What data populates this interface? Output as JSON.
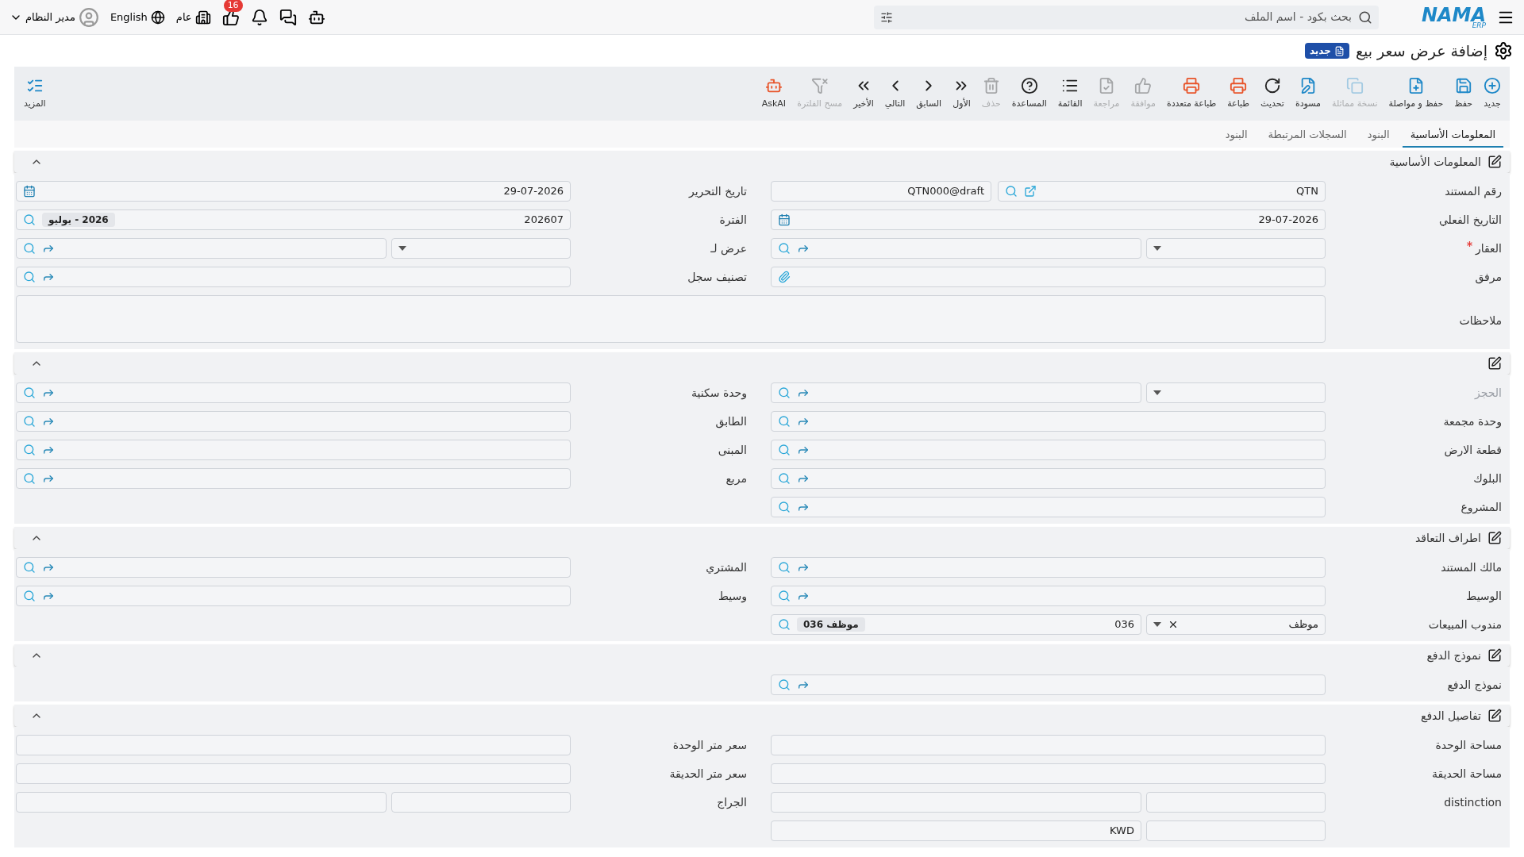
{
  "topbar": {
    "logo": "NAMA",
    "logo_sub": "ERP",
    "search": {
      "placeholder": "بحث بكود - اسم الملف"
    },
    "user": "مدير النظام",
    "language": "English",
    "scope": "عام",
    "notifications": "16"
  },
  "page": {
    "title": "إضافة عرض سعر بيع",
    "badge": "جديد"
  },
  "toolbar": [
    {
      "label": "جديد",
      "kind": "primary",
      "disabled": false
    },
    {
      "label": "حفظ",
      "kind": "primary",
      "disabled": false
    },
    {
      "label": "حفظ و مواصلة",
      "kind": "primary",
      "disabled": false
    },
    {
      "label": "نسخة مماثلة",
      "kind": "primary",
      "disabled": true
    },
    {
      "label": "مسودة",
      "kind": "primary",
      "disabled": false
    },
    {
      "label": "تحديث",
      "kind": "plain",
      "disabled": false
    },
    {
      "label": "طباعة",
      "kind": "print",
      "disabled": false
    },
    {
      "label": "طباعة متعددة",
      "kind": "print",
      "disabled": false
    },
    {
      "label": "موافقة",
      "kind": "plain",
      "disabled": true
    },
    {
      "label": "مراجعة",
      "kind": "plain",
      "disabled": true
    },
    {
      "label": "القائمة",
      "kind": "plain",
      "disabled": false
    },
    {
      "label": "المساعدة",
      "kind": "plain",
      "disabled": false
    },
    {
      "label": "حذف",
      "kind": "plain",
      "disabled": true
    },
    {
      "label": "الأول",
      "kind": "plain",
      "disabled": false
    },
    {
      "label": "السابق",
      "kind": "plain",
      "disabled": false
    },
    {
      "label": "التالي",
      "kind": "plain",
      "disabled": false
    },
    {
      "label": "الأخير",
      "kind": "plain",
      "disabled": false
    },
    {
      "label": "مسح الفلترة",
      "kind": "plain",
      "disabled": true
    },
    {
      "label": "AskAI",
      "kind": "print",
      "disabled": false
    }
  ],
  "more": "المزيد",
  "tabs": [
    {
      "label": "المعلومات الأساسية",
      "selected": true
    },
    {
      "label": "البنود",
      "selected": false
    },
    {
      "label": "السجلات المرتبطة",
      "selected": false
    },
    {
      "label": "البنود",
      "selected": false
    }
  ],
  "sections": [
    {
      "title": "المعلومات الأساسية",
      "rows": [
        [
          {
            "label": "رقم المستند",
            "kind": "doc_number",
            "value": "QTN",
            "value2": "QTN000@draft"
          },
          {
            "label": "تاريخ التحرير",
            "kind": "date",
            "value": "29-07-2026"
          }
        ],
        [
          {
            "label": "التاريخ الفعلي",
            "kind": "date",
            "value": "29-07-2026"
          },
          {
            "label": "الفترة",
            "kind": "period",
            "value": "202607",
            "tag": "2026 - يوليو"
          }
        ],
        [
          {
            "label": "العقار",
            "kind": "select_lookup",
            "required": true
          },
          {
            "label": "عرض لـ",
            "kind": "select_lookup"
          }
        ],
        [
          {
            "label": "مرفق",
            "kind": "attachment"
          },
          {
            "label": "تصنيف سجل",
            "kind": "lookup"
          }
        ],
        [
          {
            "label": "ملاحظات",
            "kind": "textarea"
          }
        ]
      ]
    },
    {
      "rows": [
        [
          {
            "label": "الحجز",
            "kind": "select_lookup",
            "disabled": true
          },
          {
            "label": "وحدة سكنية",
            "kind": "lookup"
          }
        ],
        [
          {
            "label": "وحدة مجمعة",
            "kind": "lookup"
          },
          {
            "label": "الطابق",
            "kind": "lookup"
          }
        ],
        [
          {
            "label": "قطعة الارض",
            "kind": "lookup"
          },
          {
            "label": "المبنى",
            "kind": "lookup"
          }
        ],
        [
          {
            "label": "البلوك",
            "kind": "lookup"
          },
          {
            "label": "مربع",
            "kind": "lookup"
          }
        ],
        [
          {
            "label": "المشروع",
            "kind": "lookup"
          }
        ]
      ]
    },
    {
      "title": "اطراف التعاقد",
      "rows": [
        [
          {
            "label": "مالك المستند",
            "kind": "lookup"
          },
          {
            "label": "المشتري",
            "kind": "lookup"
          }
        ],
        [
          {
            "label": "الوسيط",
            "kind": "lookup"
          },
          {
            "label": "وسيط",
            "kind": "lookup"
          }
        ],
        [
          {
            "label": "مندوب المبيعات",
            "kind": "employee",
            "value": "موظف",
            "value2": "036",
            "tag": "موظف 036"
          }
        ]
      ]
    },
    {
      "title": "نموذج الدفع",
      "rows": [
        [
          {
            "label": "نموذج الدفع",
            "kind": "lookup"
          }
        ]
      ]
    },
    {
      "title": "تفاصيل الدفع",
      "rows": [
        [
          {
            "label": "مساحة الوحدة",
            "kind": "plain"
          },
          {
            "label": "سعر متر الوحدة",
            "kind": "plain"
          }
        ],
        [
          {
            "label": "مساحة الحديقة",
            "kind": "plain"
          },
          {
            "label": "سعر متر الحديقة",
            "kind": "plain"
          }
        ],
        [
          {
            "label": "distinction",
            "kind": "split"
          },
          {
            "label": "الجراج",
            "kind": "split"
          }
        ],
        [
          {
            "kind": "currency",
            "value2": "KWD"
          }
        ]
      ]
    }
  ]
}
